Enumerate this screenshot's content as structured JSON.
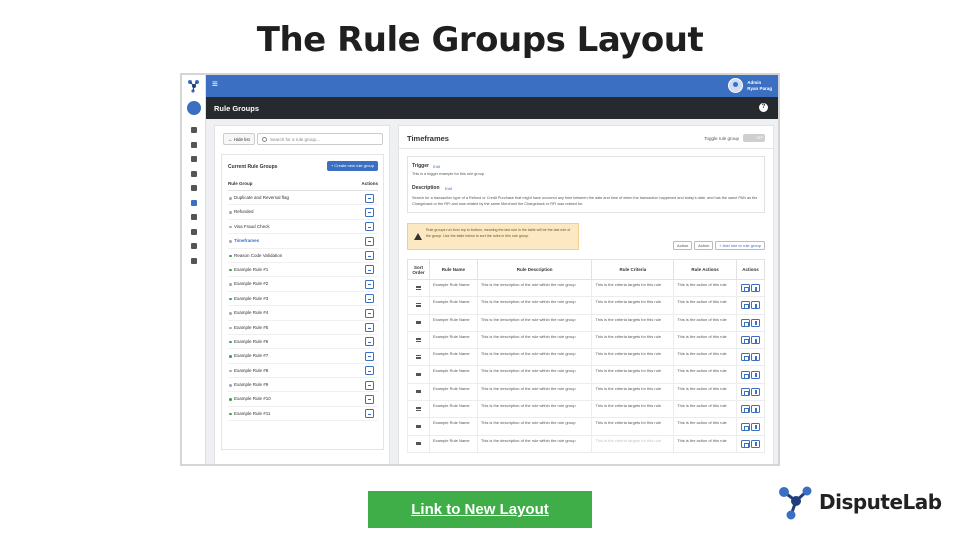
{
  "slide": {
    "title": "The Rule Groups Layout",
    "link_label": "Link to New Layout",
    "brand_name": "DisputeLab"
  },
  "app": {
    "user_role": "Admin",
    "user_name": "Ryan Parag",
    "page_title": "Rule Groups",
    "colors": {
      "primary": "#3b6fc1",
      "pagebar": "#26292e",
      "active_dot": "#3aa54a",
      "warning": "#fde8c4",
      "link_button": "#3fae49"
    }
  },
  "sidebar_icons": [
    "home-icon",
    "briefcase-icon",
    "chart-icon",
    "mail-icon",
    "card-icon",
    "gear-icon",
    "document-icon",
    "warning-icon",
    "users-icon",
    "sliders-icon"
  ],
  "left_panel": {
    "hide_label": "Hide list",
    "search_placeholder": "Search for a rule group...",
    "heading": "Current Rule Groups",
    "create_label": "Create new rule group",
    "col_group": "Rule Group",
    "col_actions": "Actions",
    "groups": [
      {
        "label": "Duplicate and Reversal flag",
        "active": false,
        "selected": false
      },
      {
        "label": "Refunded",
        "active": false,
        "selected": false
      },
      {
        "label": "Visa Fraud Check",
        "active": false,
        "selected": false
      },
      {
        "label": "Timeframes",
        "active": false,
        "selected": true
      },
      {
        "label": "Reason Code Validation",
        "active": true,
        "selected": false
      },
      {
        "label": "Example Rule #1",
        "active": true,
        "selected": false
      },
      {
        "label": "Example Rule #2",
        "active": false,
        "selected": false
      },
      {
        "label": "Example Rule #3",
        "active": true,
        "selected": false
      },
      {
        "label": "Example Rule #4",
        "active": false,
        "selected": false
      },
      {
        "label": "Example Rule #5",
        "active": false,
        "selected": false
      },
      {
        "label": "Example Rule #6",
        "active": true,
        "selected": false
      },
      {
        "label": "Example Rule #7",
        "active": true,
        "selected": false
      },
      {
        "label": "Example Rule #8",
        "active": false,
        "selected": false
      },
      {
        "label": "Example Rule #9",
        "active": false,
        "selected": false
      },
      {
        "label": "Example Rule #10",
        "active": true,
        "selected": false
      },
      {
        "label": "Example Rule #11",
        "active": true,
        "selected": false
      }
    ]
  },
  "right_panel": {
    "title": "Timeframes",
    "toggle_label": "Toggle rule group",
    "toggle_state": "OFF",
    "trigger_label": "Trigger",
    "trigger_edit": "Edit",
    "trigger_text": "This is a trigger example for this rule group",
    "description_label": "Description",
    "description_edit": "Edit",
    "description_text": "Search for a transaction type of a Refund or Credit Purchase that might have occurred any time between the date and time of when the transaction happened and today's date, and has the same PAN as the Chargeback or the RFI and was related by the same Merchant the Chargeback or RFI was related for.",
    "warning_text": "Rule groups run from top to bottom, meaning the last rule in the table will be the last rule of the group. Use the table below to sort the rules in this rule group.",
    "action1": "Action",
    "action2": "Action",
    "add_rule": "+ Add rule to rule group",
    "table_headers": [
      "Sort Order",
      "Rule Name",
      "Rule Description",
      "Rule Criteria",
      "Rule Actions",
      "Actions"
    ],
    "rows": [
      {
        "name": "Example Rule Name",
        "description": "This is the description of the rule within the rule group",
        "criteria": "This is the criteria targets for this rule",
        "actions": "This is the action of this rule"
      },
      {
        "name": "Example Rule Name",
        "description": "This is the description of the rule within the rule group",
        "criteria": "This is the criteria targets for this rule",
        "actions": "This is the action of this rule"
      },
      {
        "name": "Example Rule Name",
        "description": "This is the description of the rule within the rule group",
        "criteria": "This is the criteria targets for this rule",
        "actions": "This is the action of this rule"
      },
      {
        "name": "Example Rule Name",
        "description": "This is the description of the rule within the rule group",
        "criteria": "This is the criteria targets for this rule",
        "actions": "This is the action of this rule"
      },
      {
        "name": "Example Rule Name",
        "description": "This is the description of the rule within the rule group",
        "criteria": "This is the criteria targets for this rule",
        "actions": "This is the action of this rule"
      },
      {
        "name": "Example Rule Name",
        "description": "This is the description of the rule within the rule group",
        "criteria": "This is the criteria targets for this rule",
        "actions": "This is the action of this rule"
      },
      {
        "name": "Example Rule Name",
        "description": "This is the description of the rule within the rule group",
        "criteria": "This is the criteria targets for this rule",
        "actions": "This is the action of this rule"
      },
      {
        "name": "Example Rule Name",
        "description": "This is the description of the rule within the rule group",
        "criteria": "This is the criteria targets for this rule",
        "actions": "This is the action of this rule"
      },
      {
        "name": "Example Rule Name",
        "description": "This is the description of the rule within the rule group",
        "criteria": "This is the criteria targets for this rule",
        "actions": "This is the action of this rule"
      },
      {
        "name": "Example Rule Name",
        "description": "This is the description of the rule within the rule group",
        "criteria": "This is the criteria targets for this rule",
        "actions": "This is the action of this rule"
      }
    ]
  }
}
